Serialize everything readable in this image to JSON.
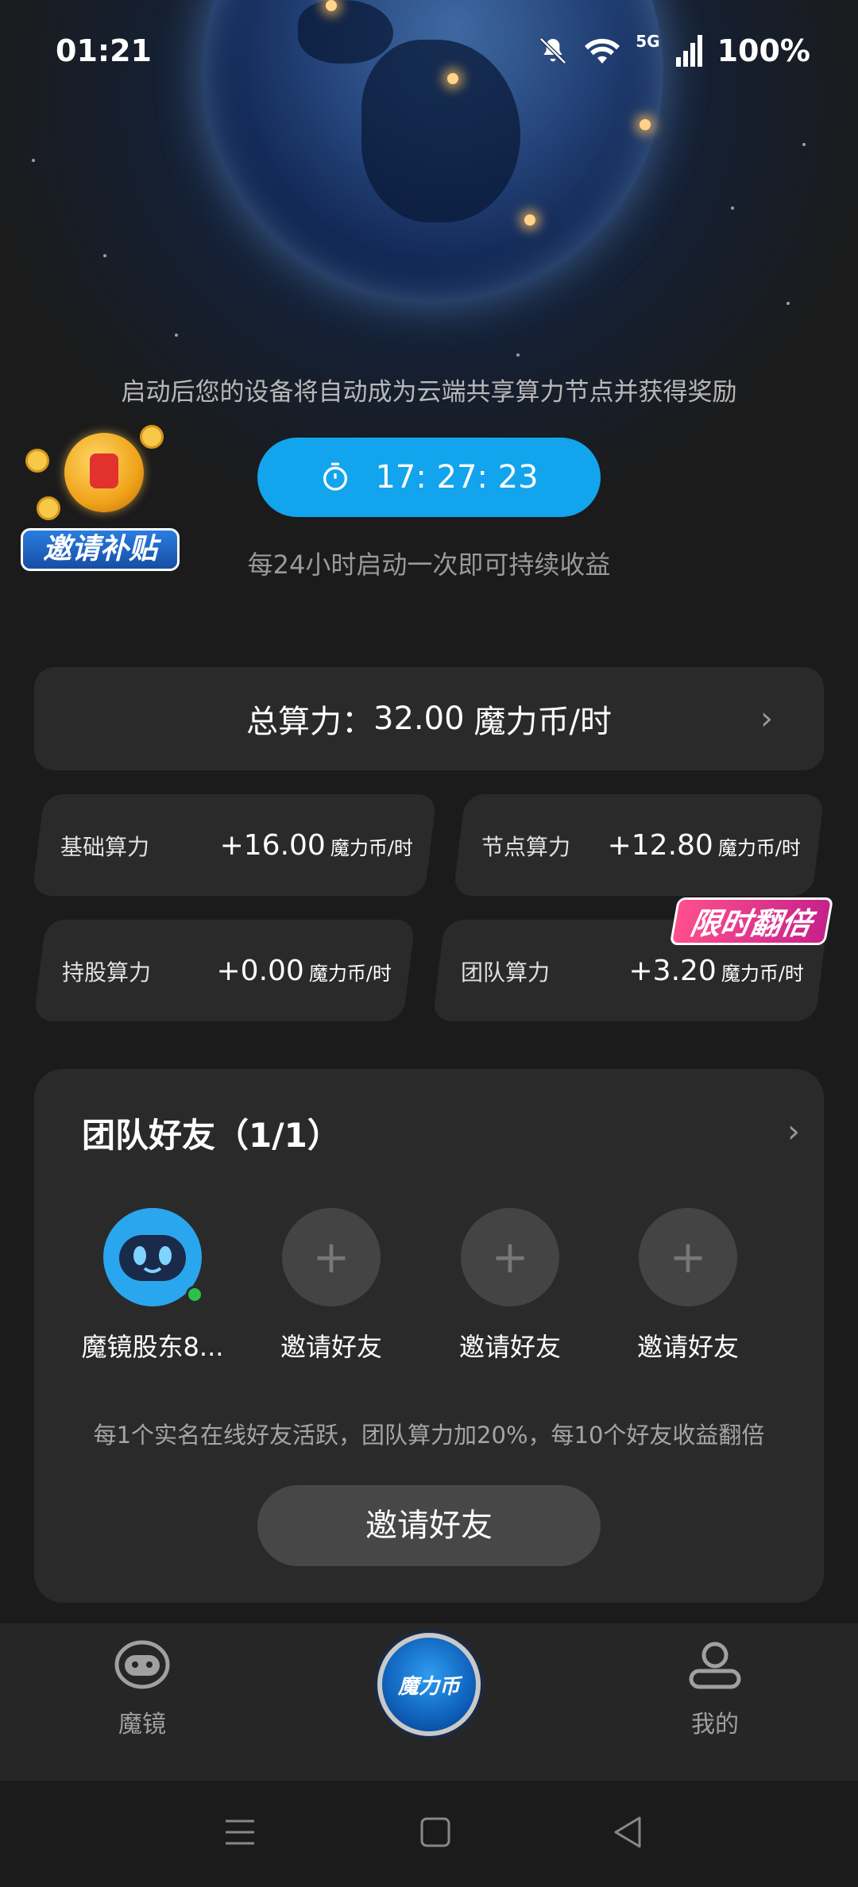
{
  "status_bar": {
    "time": "01:21",
    "network": "5G",
    "battery": "100%"
  },
  "hero": {
    "description": "启动后您的设备将自动成为云端共享算力节点并获得奖励",
    "invite_badge_label": "邀请补贴",
    "timer": "17: 27: 23",
    "subtext": "每24小时启动一次即可持续收益"
  },
  "total_power": {
    "label": "总算力：",
    "value": "32.00",
    "unit": "魔力币/时"
  },
  "stats": [
    {
      "name": "基础算力",
      "value": "+16.00",
      "unit": "魔力币/时"
    },
    {
      "name": "节点算力",
      "value": "+12.80",
      "unit": "魔力币/时"
    },
    {
      "name": "持股算力",
      "value": "+0.00",
      "unit": "魔力币/时"
    },
    {
      "name": "团队算力",
      "value": "+3.20",
      "unit": "魔力币/时"
    }
  ],
  "double_badge": "限时翻倍",
  "team": {
    "title": "团队好友（1/1）",
    "members": [
      {
        "name": "魔镜股东8..."
      },
      {
        "name": "邀请好友"
      },
      {
        "name": "邀请好友"
      },
      {
        "name": "邀请好友"
      }
    ],
    "note": "每1个实名在线好友活跃，团队算力加20%，每10个好友收益翻倍",
    "invite_button": "邀请好友"
  },
  "bottom_nav": {
    "left": "魔镜",
    "center": "魔力币",
    "right": "我的"
  },
  "colors": {
    "accent": "#12a4ec",
    "card": "#2a2a2a",
    "background": "#1b1b1b",
    "online": "#2bc24c",
    "badge": "#ff4f8d"
  }
}
